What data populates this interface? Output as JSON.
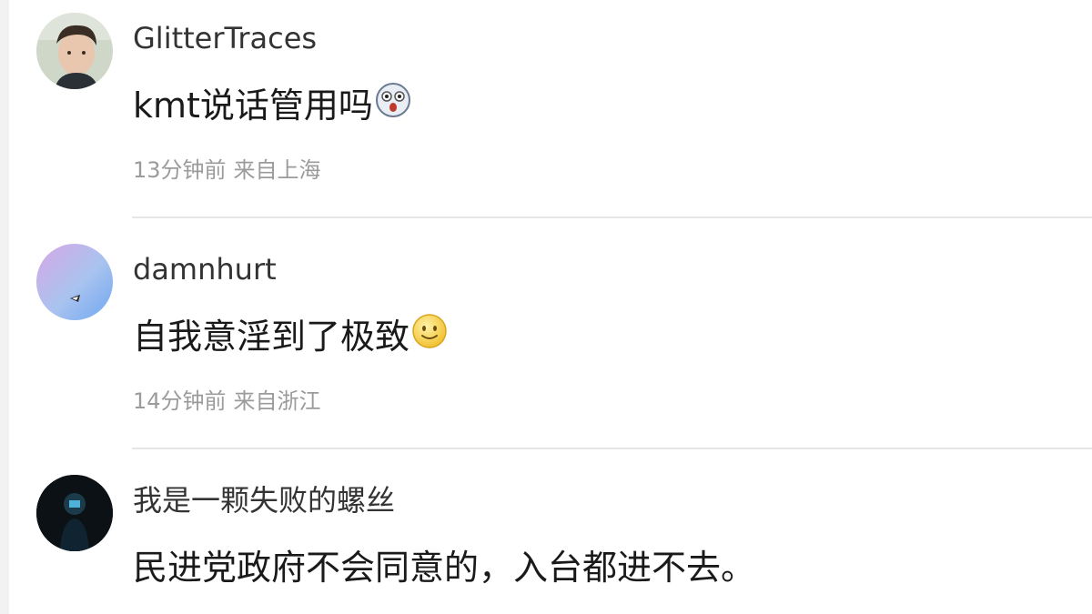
{
  "comments": [
    {
      "username": "GlitterTraces",
      "text": "kmt说话管用吗",
      "emoji_icon": "surprised-face-icon",
      "time": "13分钟前",
      "location": "来自上海"
    },
    {
      "username": "damnhurt",
      "text": "自我意淫到了极致",
      "emoji_icon": "smile-face-icon",
      "time": "14分钟前",
      "location": "来自浙江"
    },
    {
      "username": "我是一颗失败的螺丝",
      "text": "民进党政府不会同意的，入台都进不去。"
    }
  ],
  "colors": {
    "username": "#333333",
    "text": "#1a1a1a",
    "meta": "#9b9b9b",
    "divider": "#e6e6e6"
  }
}
